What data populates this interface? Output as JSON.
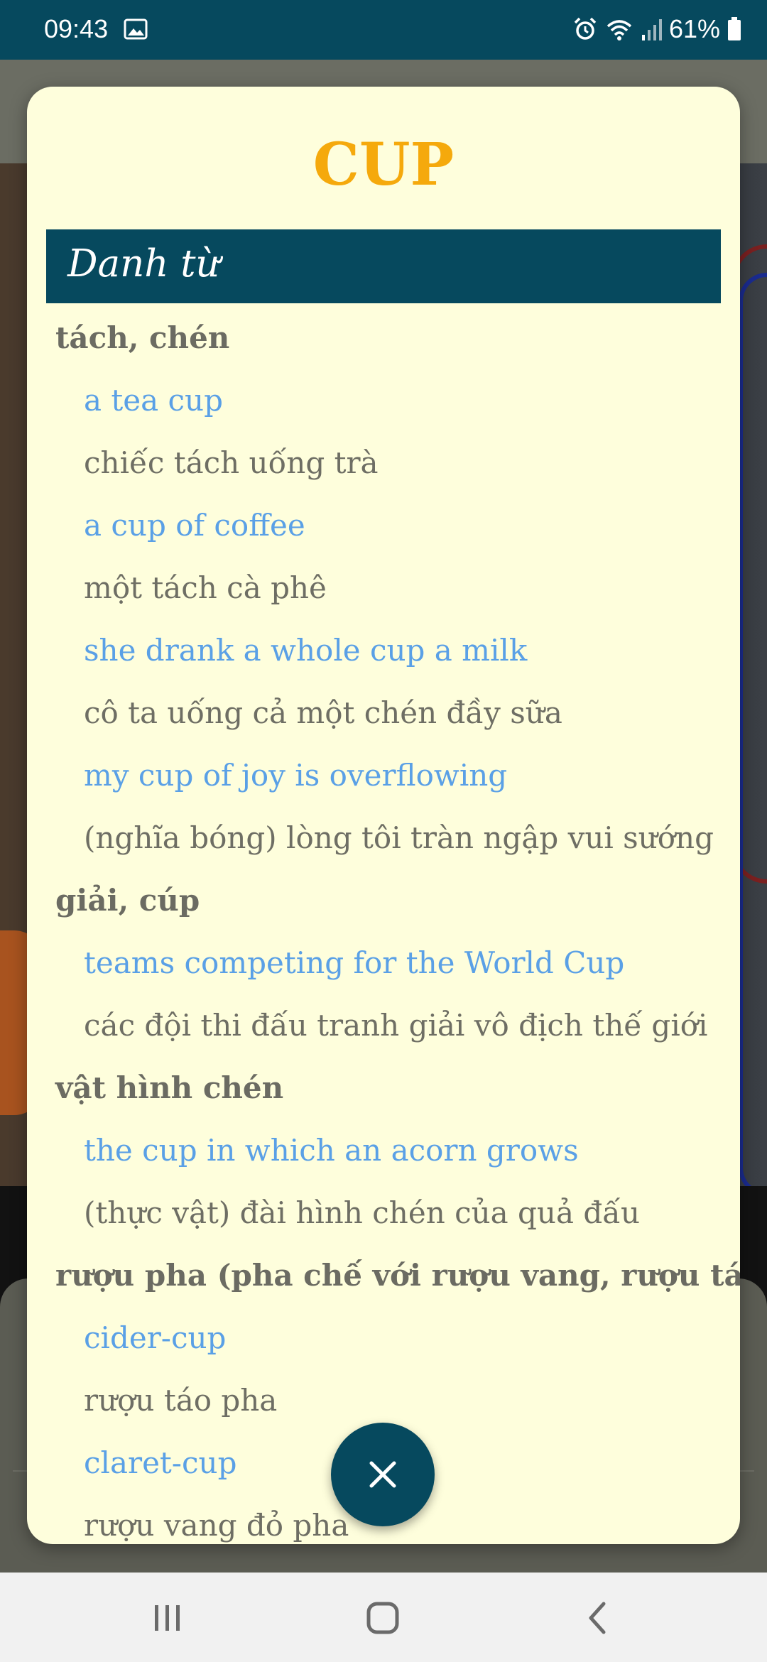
{
  "status_bar": {
    "time": "09:43",
    "battery": "61%",
    "icons": [
      "image-icon",
      "alarm-icon",
      "wifi-icon",
      "signal-icon",
      "battery-icon"
    ]
  },
  "dialog": {
    "word": "CUP",
    "part_of_speech": "Danh từ",
    "entries": [
      {
        "type": "sense",
        "text": "tách, chén"
      },
      {
        "type": "example",
        "text": "a tea cup"
      },
      {
        "type": "translation",
        "text": "chiếc tách uống trà"
      },
      {
        "type": "example",
        "text": "a cup of coffee"
      },
      {
        "type": "translation",
        "text": "một tách cà phê"
      },
      {
        "type": "example",
        "text": "she drank a whole cup a milk"
      },
      {
        "type": "translation",
        "text": "cô ta uống cả một chén đầy sữa"
      },
      {
        "type": "example",
        "text": "my cup of joy is overflowing"
      },
      {
        "type": "translation",
        "text": "(nghĩa bóng) lòng tôi tràn ngập vui sướng"
      },
      {
        "type": "sense",
        "text": "giải, cúp"
      },
      {
        "type": "example",
        "text": "teams competing for the World Cup"
      },
      {
        "type": "translation",
        "text": "các đội thi đấu tranh giải vô địch thế giới"
      },
      {
        "type": "sense",
        "text": "vật hình chén"
      },
      {
        "type": "example",
        "text": "the cup in which an acorn grows"
      },
      {
        "type": "translation",
        "text": "(thực vật) đài hình chén của quả đấu"
      },
      {
        "type": "sense",
        "text": "rượu pha (pha chế với rượu vang, rượu táo)"
      },
      {
        "type": "example",
        "text": "cider-cup"
      },
      {
        "type": "translation",
        "text": "rượu táo pha"
      },
      {
        "type": "example",
        "text": "claret-cup"
      },
      {
        "type": "translation",
        "text": "rượu vang đỏ pha"
      }
    ],
    "close_icon": "close-icon"
  },
  "nav_bar": {
    "icons": [
      "recents-icon",
      "home-icon",
      "back-icon"
    ]
  },
  "colors": {
    "header_bg": "#06495e",
    "title": "#f5a90c",
    "example_text": "#5aa0e6",
    "dialog_bg": "#fefedc"
  }
}
